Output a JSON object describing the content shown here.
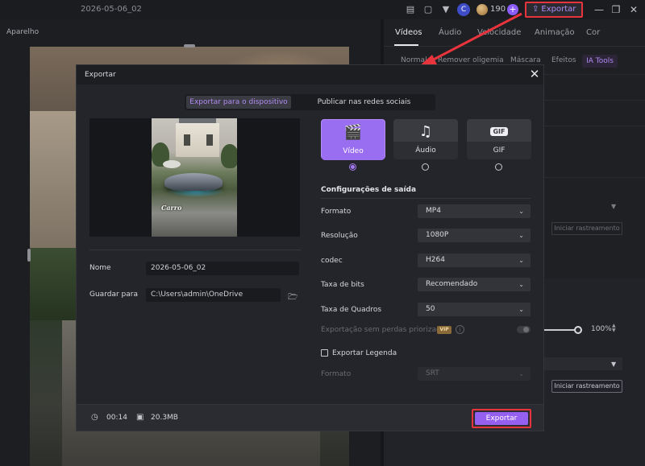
{
  "app": {
    "project_title": "2026-05-06_02",
    "credits": "190",
    "avatar_initial": "C",
    "export_label": "Exportar"
  },
  "player": {
    "panel_label": "Aparelho"
  },
  "properties": {
    "tabs": [
      "Vídeos",
      "Áudio",
      "Velocidade",
      "Animação",
      "Cor"
    ],
    "active_tab": "Vídeos",
    "subtabs": [
      "Normal",
      "Remover oligemia",
      "Máscara",
      "Efeitos",
      "IA Tools"
    ],
    "active_subtab": "IA Tools",
    "tracking_label": "Iniciar rastreamento",
    "percent": "100%"
  },
  "modal": {
    "title": "Exportar",
    "segments": {
      "device": "Exportar para o dispositivo",
      "social": "Publicar nas redes sociais"
    },
    "thumbnail_tag": "Carro",
    "name_label": "Nome",
    "name_value": "2026-05-06_02",
    "save_label": "Guardar para",
    "save_path": "C:\\Users\\admin\\OneDrive",
    "media_types": [
      {
        "label": "Vídeo",
        "icon": "video-clapper-icon",
        "selected": true
      },
      {
        "label": "Áudio",
        "icon": "music-note-icon",
        "selected": false
      },
      {
        "label": "GIF",
        "icon": "gif-icon",
        "selected": false
      }
    ],
    "output_settings_title": "Configurações de saída",
    "options": [
      {
        "label": "Formato",
        "value": "MP4"
      },
      {
        "label": "Resolução",
        "value": "1080P"
      },
      {
        "label": "codec",
        "value": "H264"
      },
      {
        "label": "Taxa de bits",
        "value": "Recomendado"
      },
      {
        "label": "Taxa de Quadros",
        "value": "50"
      }
    ],
    "lossless_label": "Exportação sem perdas priorizada",
    "vip_badge": "VIP",
    "subtitle_label": "Exportar Legenda",
    "subtitle_format_label": "Formato",
    "subtitle_format_value": "SRT",
    "duration": "00:14",
    "file_size": "20.3MB",
    "export_button": "Exportar"
  },
  "colors": {
    "accent": "#9560ef",
    "highlight_red": "#e8343c",
    "background": "#15161a"
  }
}
